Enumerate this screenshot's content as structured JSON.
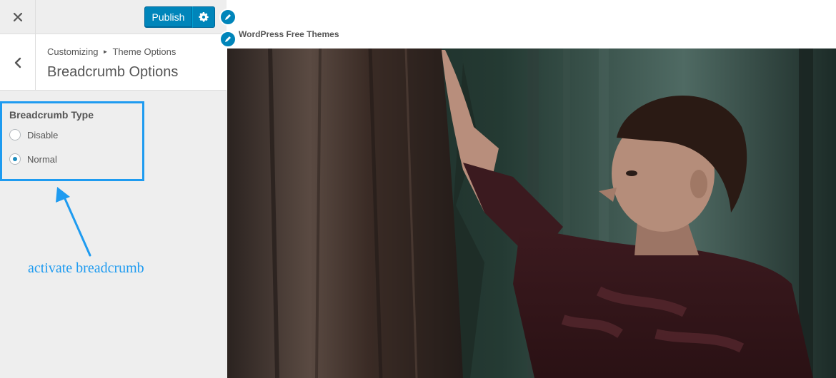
{
  "topbar": {
    "close_icon": "close-icon",
    "publish_label": "Publish",
    "settings_icon": "gear-icon",
    "accent": "#0085ba"
  },
  "section": {
    "breadcrumb_root": "Customizing",
    "breadcrumb_parent": "Theme Options",
    "title": "Breadcrumb Options"
  },
  "control": {
    "title": "Breadcrumb Type",
    "options": [
      {
        "label": "Disable",
        "checked": false
      },
      {
        "label": "Normal",
        "checked": true
      }
    ]
  },
  "annotation": {
    "text": "activate breadcrumb",
    "color": "#1e9bf0"
  },
  "preview": {
    "site_title": "WordPress Free Themes"
  }
}
